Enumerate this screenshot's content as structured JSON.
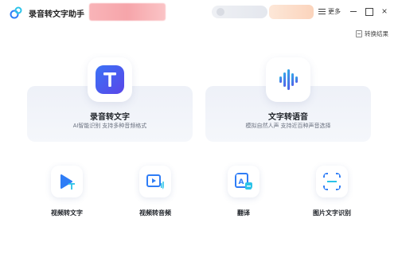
{
  "titlebar": {
    "app_title": "录音转文字助手",
    "more_label": "更多",
    "close_glyph": "×"
  },
  "result_link": "转换结果",
  "cards": [
    {
      "title": "录音转文字",
      "subtitle": "AI智能识别 支持多种音频格式"
    },
    {
      "title": "文字转语音",
      "subtitle": "模拟自然人声 支持近百种声音选择"
    }
  ],
  "tools": [
    {
      "label": "视频转文字"
    },
    {
      "label": "视频转音频"
    },
    {
      "label": "翻译"
    },
    {
      "label": "图片文字识别"
    }
  ],
  "colors": {
    "accent_blue": "#3a73f6",
    "accent_purple": "#5a45e8",
    "cyan": "#2bc3e8"
  }
}
